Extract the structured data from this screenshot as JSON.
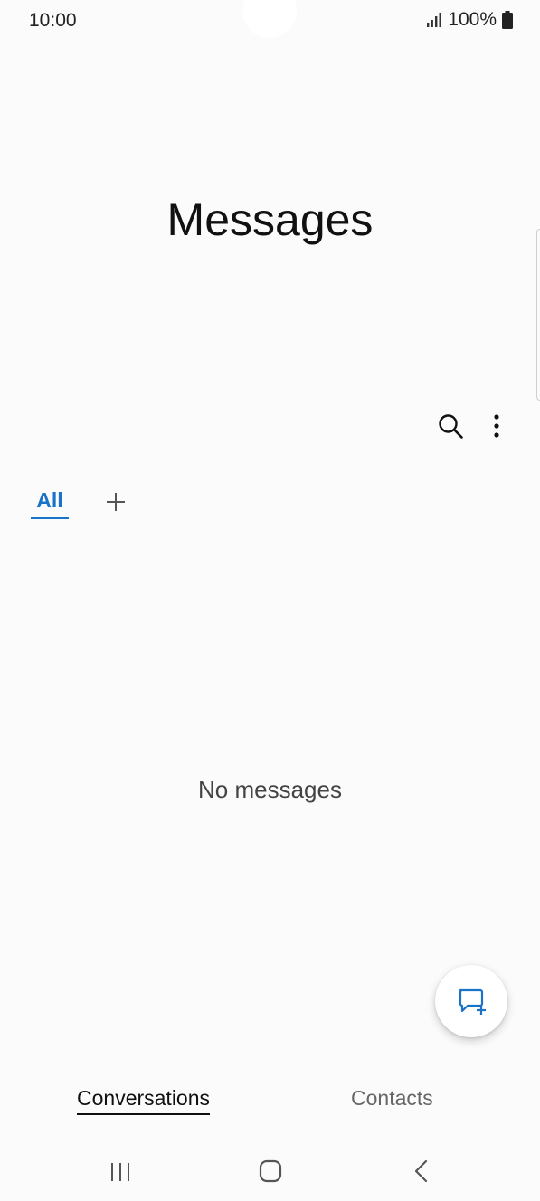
{
  "status_bar": {
    "time": "10:00",
    "battery": "100%",
    "icons": [
      "signal-icon",
      "battery-icon"
    ]
  },
  "header": {
    "title": "Messages"
  },
  "toolbar": {
    "icons": [
      "search-icon",
      "more-options-icon"
    ]
  },
  "filter_tabs": {
    "active_label": "All",
    "add_icon": "plus-icon"
  },
  "conversation_list": {
    "empty_text": "No messages"
  },
  "fab": {
    "icon": "new-message-icon"
  },
  "bottom_tabs": {
    "items": [
      {
        "label": "Conversations",
        "active": true
      },
      {
        "label": "Contacts",
        "active": false
      }
    ]
  },
  "nav_bar": {
    "icons": [
      "recents-icon",
      "home-icon",
      "back-icon"
    ]
  },
  "colors": {
    "accent": "#1a73c9",
    "background": "#fbfbfb"
  }
}
